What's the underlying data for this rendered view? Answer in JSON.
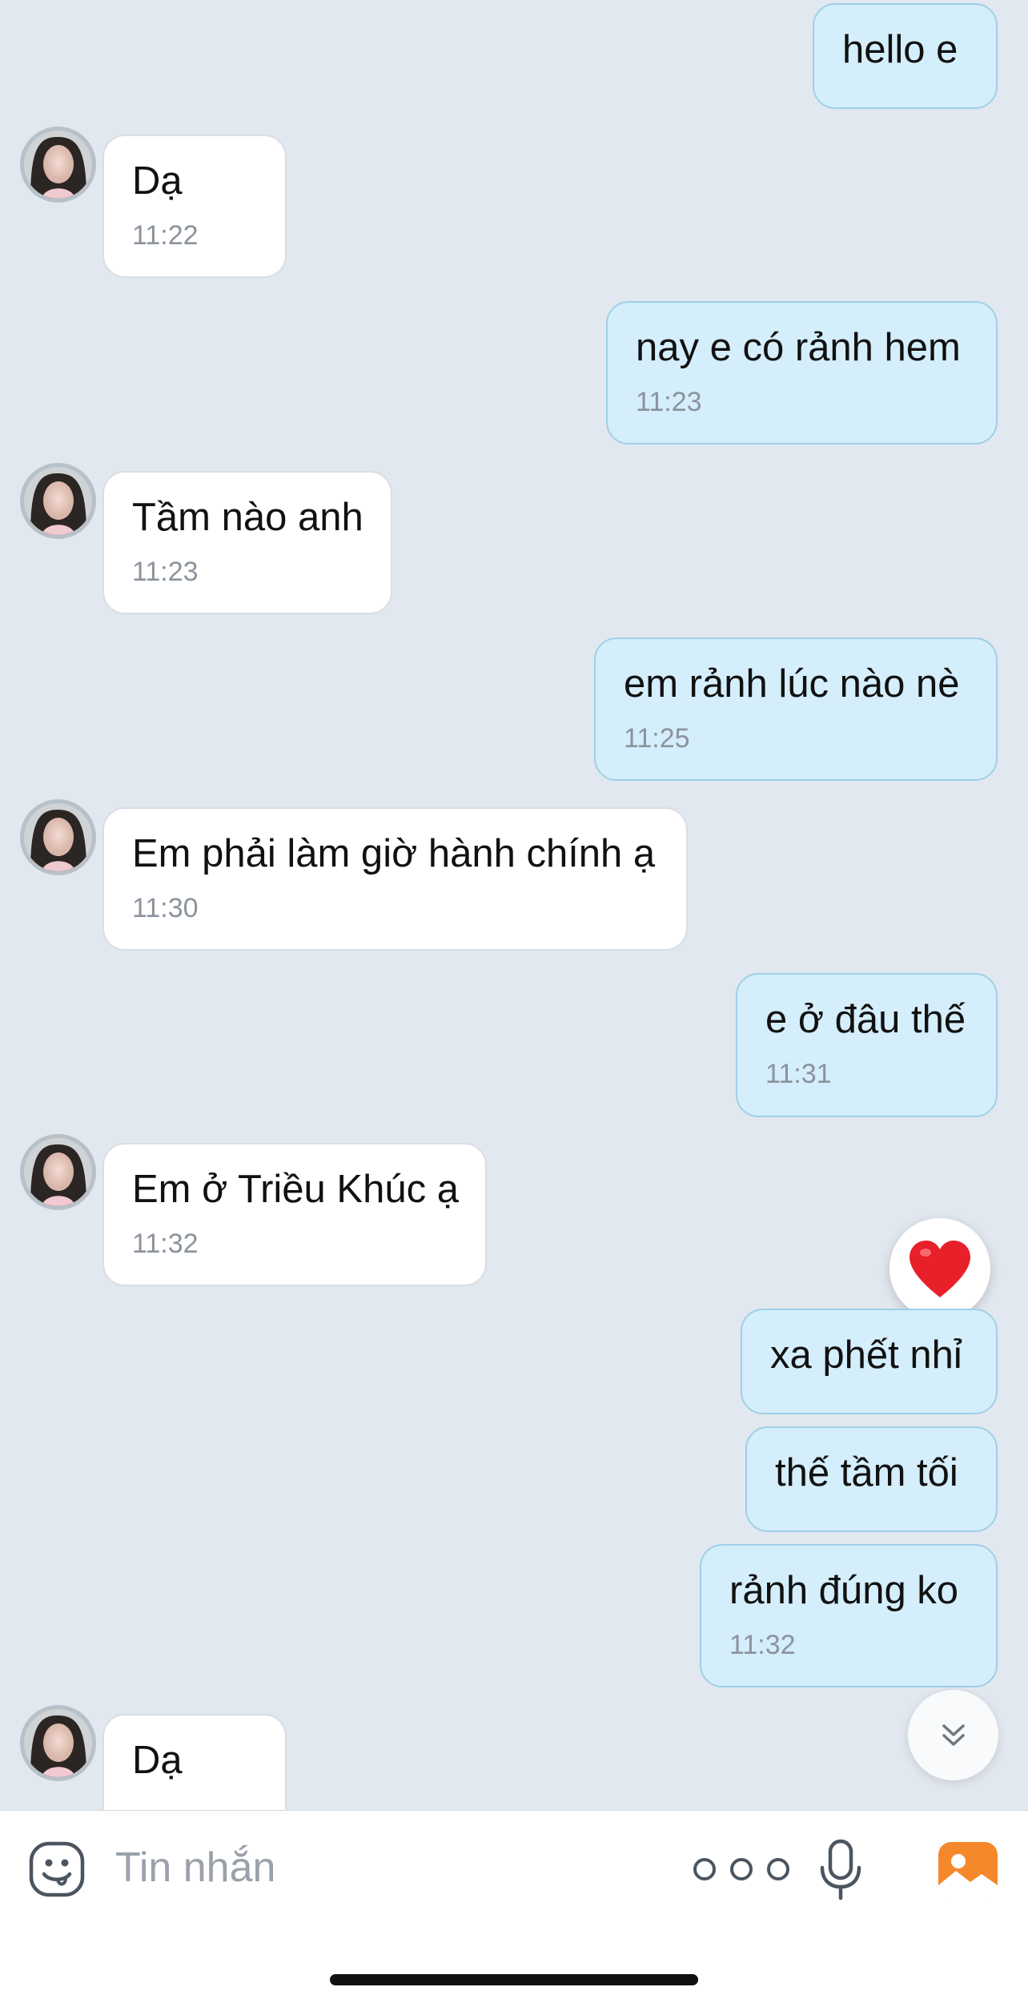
{
  "colors": {
    "background": "#e2e8ef",
    "outgoing_bubble": "#d4eefb",
    "incoming_bubble": "#ffffff",
    "timestamp": "#8b939c",
    "heart": "#e8202a",
    "image_icon": "#f5882a"
  },
  "messages": [
    {
      "side": "outgoing",
      "text": "hello e",
      "time": ""
    },
    {
      "side": "incoming",
      "text": "Dạ",
      "time": "11:22"
    },
    {
      "side": "outgoing",
      "text": "nay e có rảnh hem",
      "time": "11:23"
    },
    {
      "side": "incoming",
      "text": "Tầm nào anh",
      "time": "11:23"
    },
    {
      "side": "outgoing",
      "text": "em rảnh lúc nào nè",
      "time": "11:25"
    },
    {
      "side": "incoming",
      "text": "Em phải làm giờ hành chính ạ",
      "time": "11:30"
    },
    {
      "side": "outgoing",
      "text": "e ở đâu thế",
      "time": "11:31"
    },
    {
      "side": "incoming",
      "text": "Em ở Triều Khúc ạ",
      "time": "11:32"
    },
    {
      "side": "outgoing",
      "text": "xa phết nhỉ",
      "time": "",
      "reaction": "heart-icon"
    },
    {
      "side": "outgoing",
      "text": "thế tầm tối",
      "time": ""
    },
    {
      "side": "outgoing",
      "text": "rảnh đúng ko",
      "time": "11:32"
    },
    {
      "side": "incoming",
      "text": "Dạ",
      "time": ""
    }
  ],
  "composer": {
    "placeholder": "Tin nhắn",
    "icons": [
      "emoji-icon",
      "more-dots-icon",
      "microphone-icon",
      "image-icon"
    ]
  },
  "scroll_button_icon": "chevron-double-down-icon"
}
